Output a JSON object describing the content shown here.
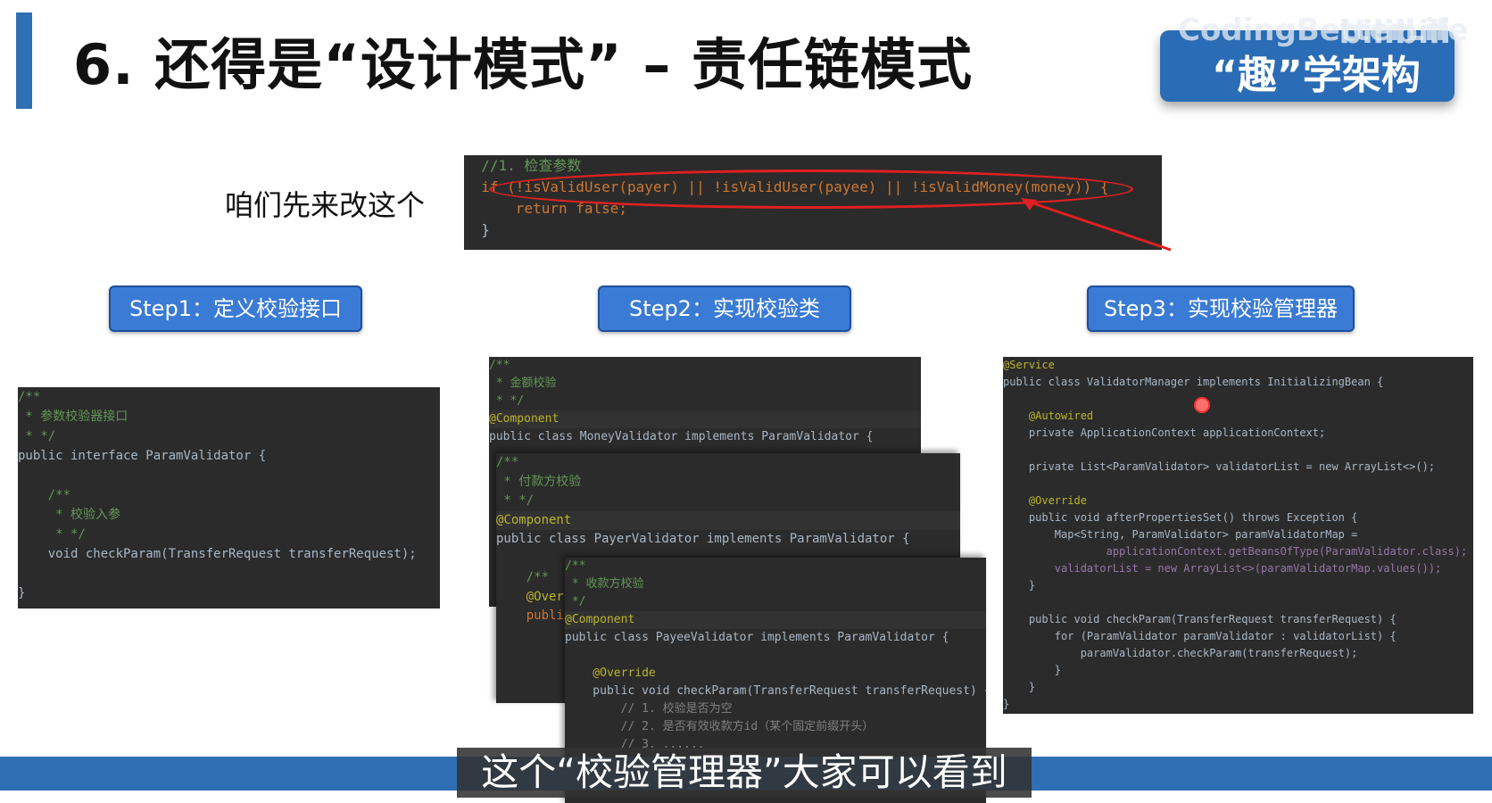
{
  "slide": {
    "title": "6. 还得是“设计模式” – 责任链模式",
    "brand_top": "CodingBetterLife",
    "brand_logo": "bilibili",
    "brand_main": "“趣”学架构",
    "lead_text": "咱们先来改这个"
  },
  "top_code": [
    "  //1. 检查参数",
    "  if (!isValidUser(payer) || !isValidUser(payee) || !isValidMoney(money)) {",
    "      return false;",
    "  }"
  ],
  "steps": [
    {
      "label": "Step1：定义校验接口"
    },
    {
      "label": "Step2：实现校验类"
    },
    {
      "label": "Step3：实现校验管理器"
    }
  ],
  "code_step1": [
    "/**",
    " * 参数校验器接口",
    " * */",
    "public interface ParamValidator {",
    "",
    "    /**",
    "     * 校验入参",
    "     * */",
    "    void checkParam(TransferRequest transferRequest);",
    "",
    "}"
  ],
  "code_step2_money": [
    "/**",
    " * 金额校验",
    " * */",
    "@Component",
    "public class MoneyValidator implements ParamValidator {"
  ],
  "code_step2_payer": [
    "/**",
    " * 付款方校验",
    " * */",
    "@Component",
    "public class PayerValidator implements ParamValidator {",
    "",
    "    /**",
    "    @Over",
    "    publi"
  ],
  "code_step2_payee": [
    "/**",
    " * 收款方校验",
    " */",
    "@Component",
    "public class PayeeValidator implements ParamValidator {",
    "",
    "    @Override",
    "    public void checkParam(TransferRequest transferRequest) {",
    "        // 1. 校验是否为空",
    "        // 2. 是否有效收款方id（某个固定前缀开头）",
    "        // 3. ......"
  ],
  "code_step3": [
    "@Service",
    "public class ValidatorManager implements InitializingBean {",
    "",
    "    @Autowired",
    "    private ApplicationContext applicationContext;",
    "",
    "    private List<ParamValidator> validatorList = new ArrayList<>();",
    "",
    "    @Override",
    "    public void afterPropertiesSet() throws Exception {",
    "        Map<String, ParamValidator> paramValidatorMap =",
    "                applicationContext.getBeansOfType(ParamValidator.class);",
    "        validatorList = new ArrayList<>(paramValidatorMap.values());",
    "    }",
    "",
    "    public void checkParam(TransferRequest transferRequest) {",
    "        for (ParamValidator paramValidator : validatorList) {",
    "            paramValidator.checkParam(transferRequest);",
    "        }",
    "    }",
    "}"
  ],
  "subtitle": "这个“校验管理器”大家可以看到",
  "colors": {
    "accent": "#2f6fb3",
    "step_button": "#3a7bd5",
    "code_bg": "#2b2b2b",
    "keyword": "#cc7832",
    "comment": "#629755",
    "annotation": "#bbb529",
    "highlight_ellipse": "#e02020"
  }
}
